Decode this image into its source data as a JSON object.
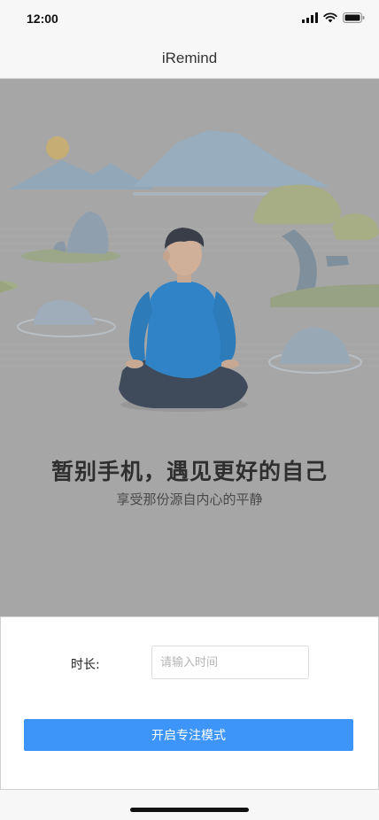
{
  "status_bar": {
    "time": "12:00",
    "icons": [
      "cellular-signal-icon",
      "wifi-icon",
      "battery-icon"
    ]
  },
  "nav": {
    "title": "iRemind"
  },
  "hero": {
    "title": "暂别手机，遇见更好的自己",
    "subtitle": "享受那份源自内心的平静",
    "illustration": "meditating-person-illustration"
  },
  "form": {
    "duration_label": "时长:",
    "duration_input_value": "",
    "duration_placeholder": "请输入时间",
    "start_button_label": "开启专注模式"
  },
  "colors": {
    "accent": "#3d95f9",
    "hero_overlay": "#a6a6a6",
    "bar_background": "#f7f7f7"
  }
}
